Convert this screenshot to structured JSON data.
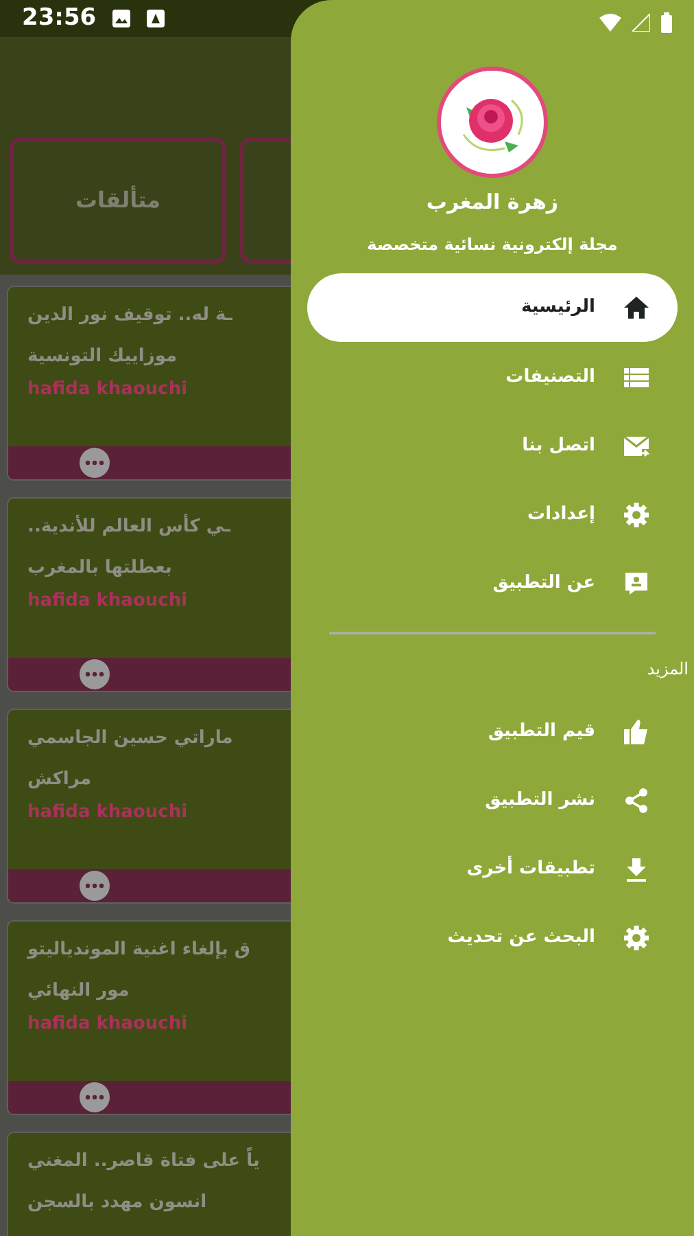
{
  "status_bar": {
    "time": "23:56"
  },
  "background": {
    "tabs": [
      {
        "kind": "label",
        "label": "متألقات"
      },
      {
        "kind": "blank"
      }
    ],
    "cards": [
      {
        "lines": [
          "ـة له.. توقيف نور الدين",
          "موزاييك  التونسية"
        ],
        "author": "hafida khaouchi"
      },
      {
        "lines": [
          "ـي كأس العالم للأندية..",
          "بعطلتها بالمغرب"
        ],
        "author": "hafida khaouchi"
      },
      {
        "lines": [
          "ماراتي حسين الجاسمي",
          "مراكش"
        ],
        "author": "hafida khaouchi"
      },
      {
        "lines": [
          "ق بإلغاء اغنية الموندياليتو",
          "مور النهائي"
        ],
        "author": "hafida khaouchi"
      },
      {
        "lines": [
          "ياً على فتاة قاصر.. المغني",
          "انسون مهدد بالسجن"
        ]
      }
    ]
  },
  "drawer": {
    "title": "زهرة المغرب",
    "subtitle": "مجلة إلكترونية نسائية متخصصة",
    "items": [
      {
        "label": "الرئيسية",
        "selected": true
      },
      {
        "label": "التصنيفات",
        "selected": false
      },
      {
        "label": "اتصل بنا",
        "selected": false
      },
      {
        "label": "إعدادات",
        "selected": false
      },
      {
        "label": "عن التطبيق",
        "selected": false
      }
    ],
    "section_title": "المزيد",
    "more_items": [
      {
        "label": "قيم التطبيق"
      },
      {
        "label": "نشر التطبيق"
      },
      {
        "label": "تطبيقات أخرى"
      },
      {
        "label": "البحث عن تحديث"
      }
    ]
  }
}
